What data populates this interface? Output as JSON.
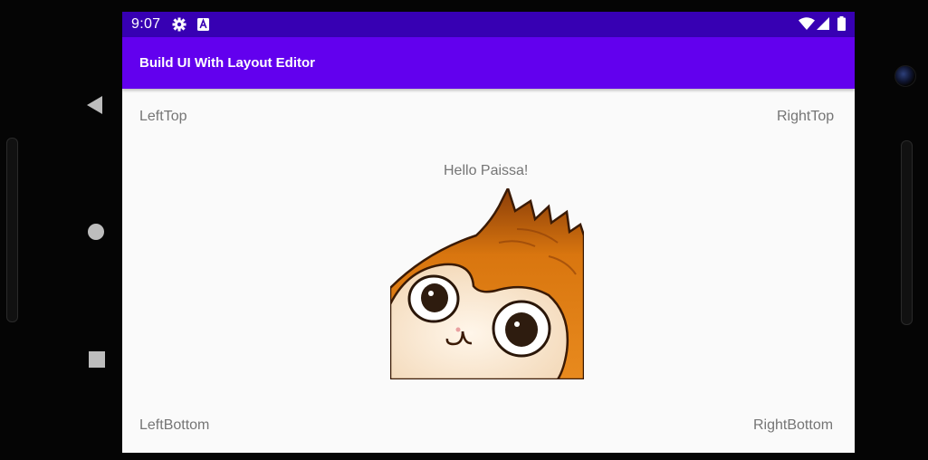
{
  "status_bar": {
    "time": "9:07",
    "left_icons": [
      "settings-icon",
      "font-a-icon"
    ],
    "right_icons": [
      "wifi-icon",
      "signal-icon",
      "battery-icon"
    ]
  },
  "app_bar": {
    "title": "Build UI With Layout Editor"
  },
  "content": {
    "left_top": "LeftTop",
    "right_top": "RightTop",
    "center_text": "Hello Paissa!",
    "image": "cartoon-creature-image",
    "left_bottom": "LeftBottom",
    "right_bottom": "RightBottom"
  },
  "colors": {
    "status_bar": "#3700b3",
    "app_bar": "#6200ee",
    "background": "#fafafa",
    "label_text": "#757575"
  },
  "nav_buttons": [
    "back-icon",
    "home-icon",
    "recents-icon"
  ]
}
